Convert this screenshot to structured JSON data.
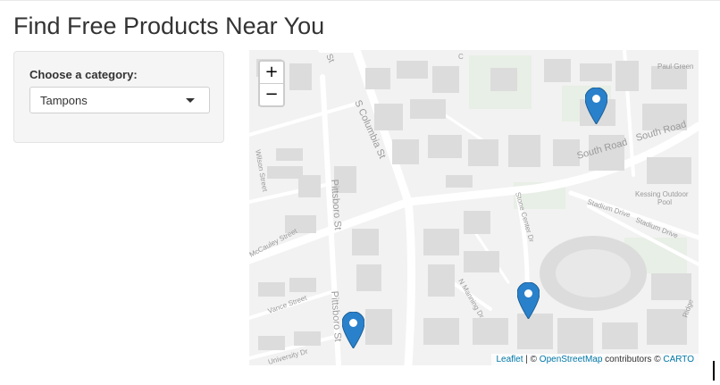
{
  "page": {
    "title": "Find Free Products Near You"
  },
  "sidebar": {
    "category_label": "Choose a category:",
    "category_selected": "Tampons"
  },
  "map": {
    "zoom_in": "+",
    "zoom_out": "−",
    "attribution": {
      "leaflet": "Leaflet",
      "sep": " | © ",
      "osm": "OpenStreetMap",
      "contrib": " contributors © ",
      "carto": "CARTO"
    },
    "street_labels": {
      "s_columbia": "S Columbia St",
      "pittsboro_1": "Pittsboro St",
      "pittsboro_2": "Pittsboro St",
      "south_road": "South Road",
      "south_road_2": "South Road",
      "stadium_drive": "Stadium Drive",
      "stadium_drive_2": "Stadium Drive",
      "stone_center": "Stone Center Dr",
      "kessing": "Kessing Outdoor",
      "kessing_2": "Pool",
      "paul_green": "Paul Green",
      "wilson": "Wilson Street",
      "mccauley": "McCauley Street",
      "vance": "Vance Street",
      "university": "University Dr",
      "manning": "N Manning Dr",
      "ridge": "Ridge",
      "top_st": "St",
      "top_c": "C"
    },
    "marker_color": "#2a81cb",
    "markers": [
      {
        "name": "marker-1"
      },
      {
        "name": "marker-2"
      },
      {
        "name": "marker-3"
      }
    ]
  },
  "colors": {
    "map_bg": "#f2f2f2",
    "building": "#dcdcdc",
    "road": "#ffffff",
    "green": "#e8efe6",
    "label": "#9a9a9a"
  }
}
